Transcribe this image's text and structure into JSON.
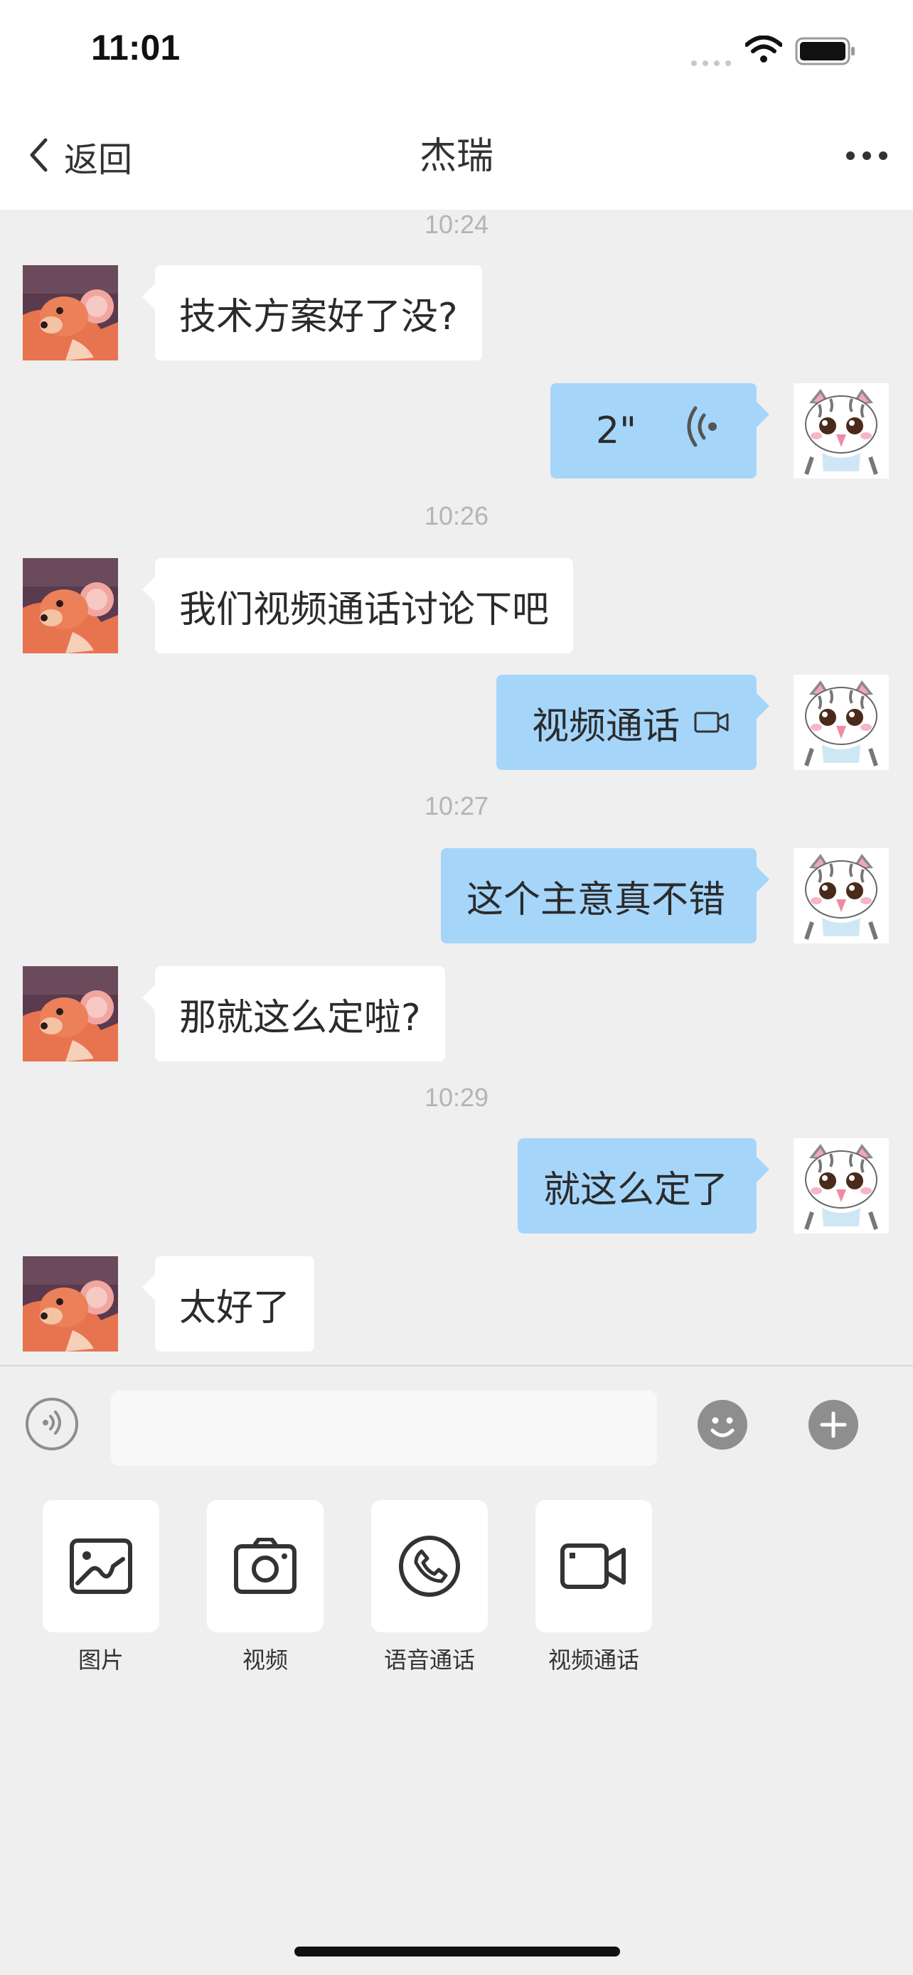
{
  "status_bar": {
    "time": "11:01"
  },
  "nav": {
    "back_label": "返回",
    "title": "杰瑞"
  },
  "messages": {
    "t1": "10:24",
    "m1": "技术方案好了没?",
    "m2_duration": "2\"",
    "t2": "10:26",
    "m3": "我们视频通话讨论下吧",
    "m4": "视频通话",
    "t3": "10:27",
    "m5": "这个主意真不错",
    "m6": "那就这么定啦?",
    "t4": "10:29",
    "m7": "就这么定了",
    "m8": "太好了"
  },
  "input": {
    "placeholder": ""
  },
  "tools": {
    "picture": "图片",
    "video": "视频",
    "voice_call": "语音通话",
    "video_call": "视频通话"
  },
  "colors": {
    "sent_bubble": "#a6d5fa",
    "received_bubble": "#ffffff",
    "chat_background": "#efefef"
  }
}
